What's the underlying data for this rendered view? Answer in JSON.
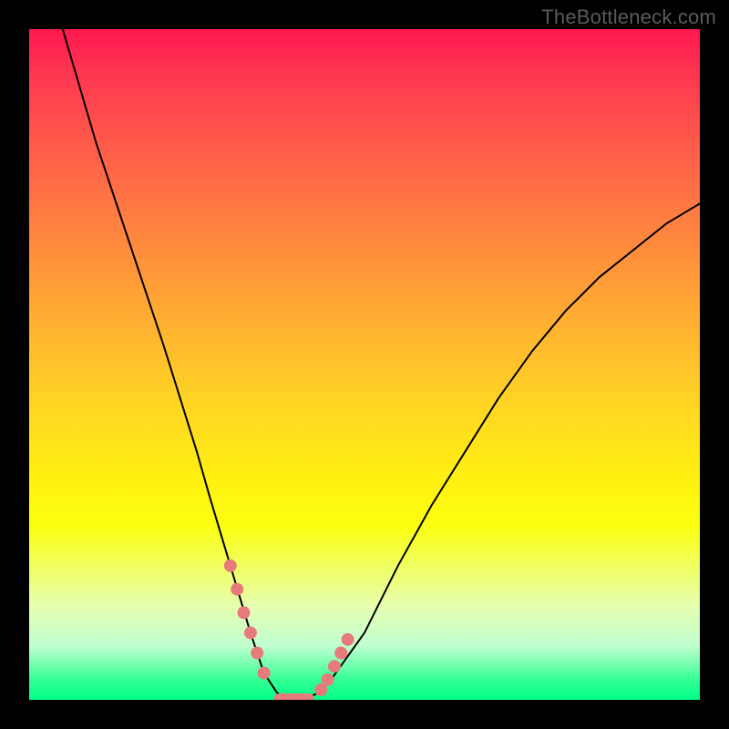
{
  "watermark": "TheBottleneck.com",
  "colors": {
    "page_bg": "#000000",
    "gradient_top": "#ff1850",
    "gradient_bottom": "#00ff88",
    "curve": "#000000",
    "marker": "#e77b7b",
    "watermark": "#5a5a5a"
  },
  "chart_data": {
    "type": "line",
    "title": "",
    "xlabel": "",
    "ylabel": "",
    "xlim": [
      0,
      100
    ],
    "ylim": [
      0,
      100
    ],
    "series": [
      {
        "name": "bottleneck-curve",
        "x": [
          5,
          10,
          15,
          20,
          25,
          27,
          30,
          33,
          35,
          37,
          39,
          41,
          43,
          45,
          50,
          55,
          60,
          65,
          70,
          75,
          80,
          85,
          90,
          95,
          100
        ],
        "y": [
          100,
          83,
          68,
          53,
          37,
          30,
          20,
          10,
          4,
          1,
          0,
          0,
          1,
          3,
          10,
          20,
          29,
          37,
          45,
          52,
          58,
          63,
          67,
          71,
          74
        ]
      }
    ],
    "markers": {
      "name": "highlighted-points",
      "x": [
        30.0,
        31.0,
        32.0,
        33.0,
        34.0,
        35.0,
        43.5,
        44.5,
        45.5,
        46.5,
        47.5
      ],
      "y": [
        20.0,
        16.5,
        13.0,
        10.0,
        7.0,
        4.0,
        1.5,
        3.0,
        5.0,
        7.0,
        9.0
      ]
    },
    "dip_band": {
      "x_start": 36.5,
      "x_end": 42.5,
      "y": 0.2,
      "thickness": 1.5
    },
    "annotations": []
  }
}
